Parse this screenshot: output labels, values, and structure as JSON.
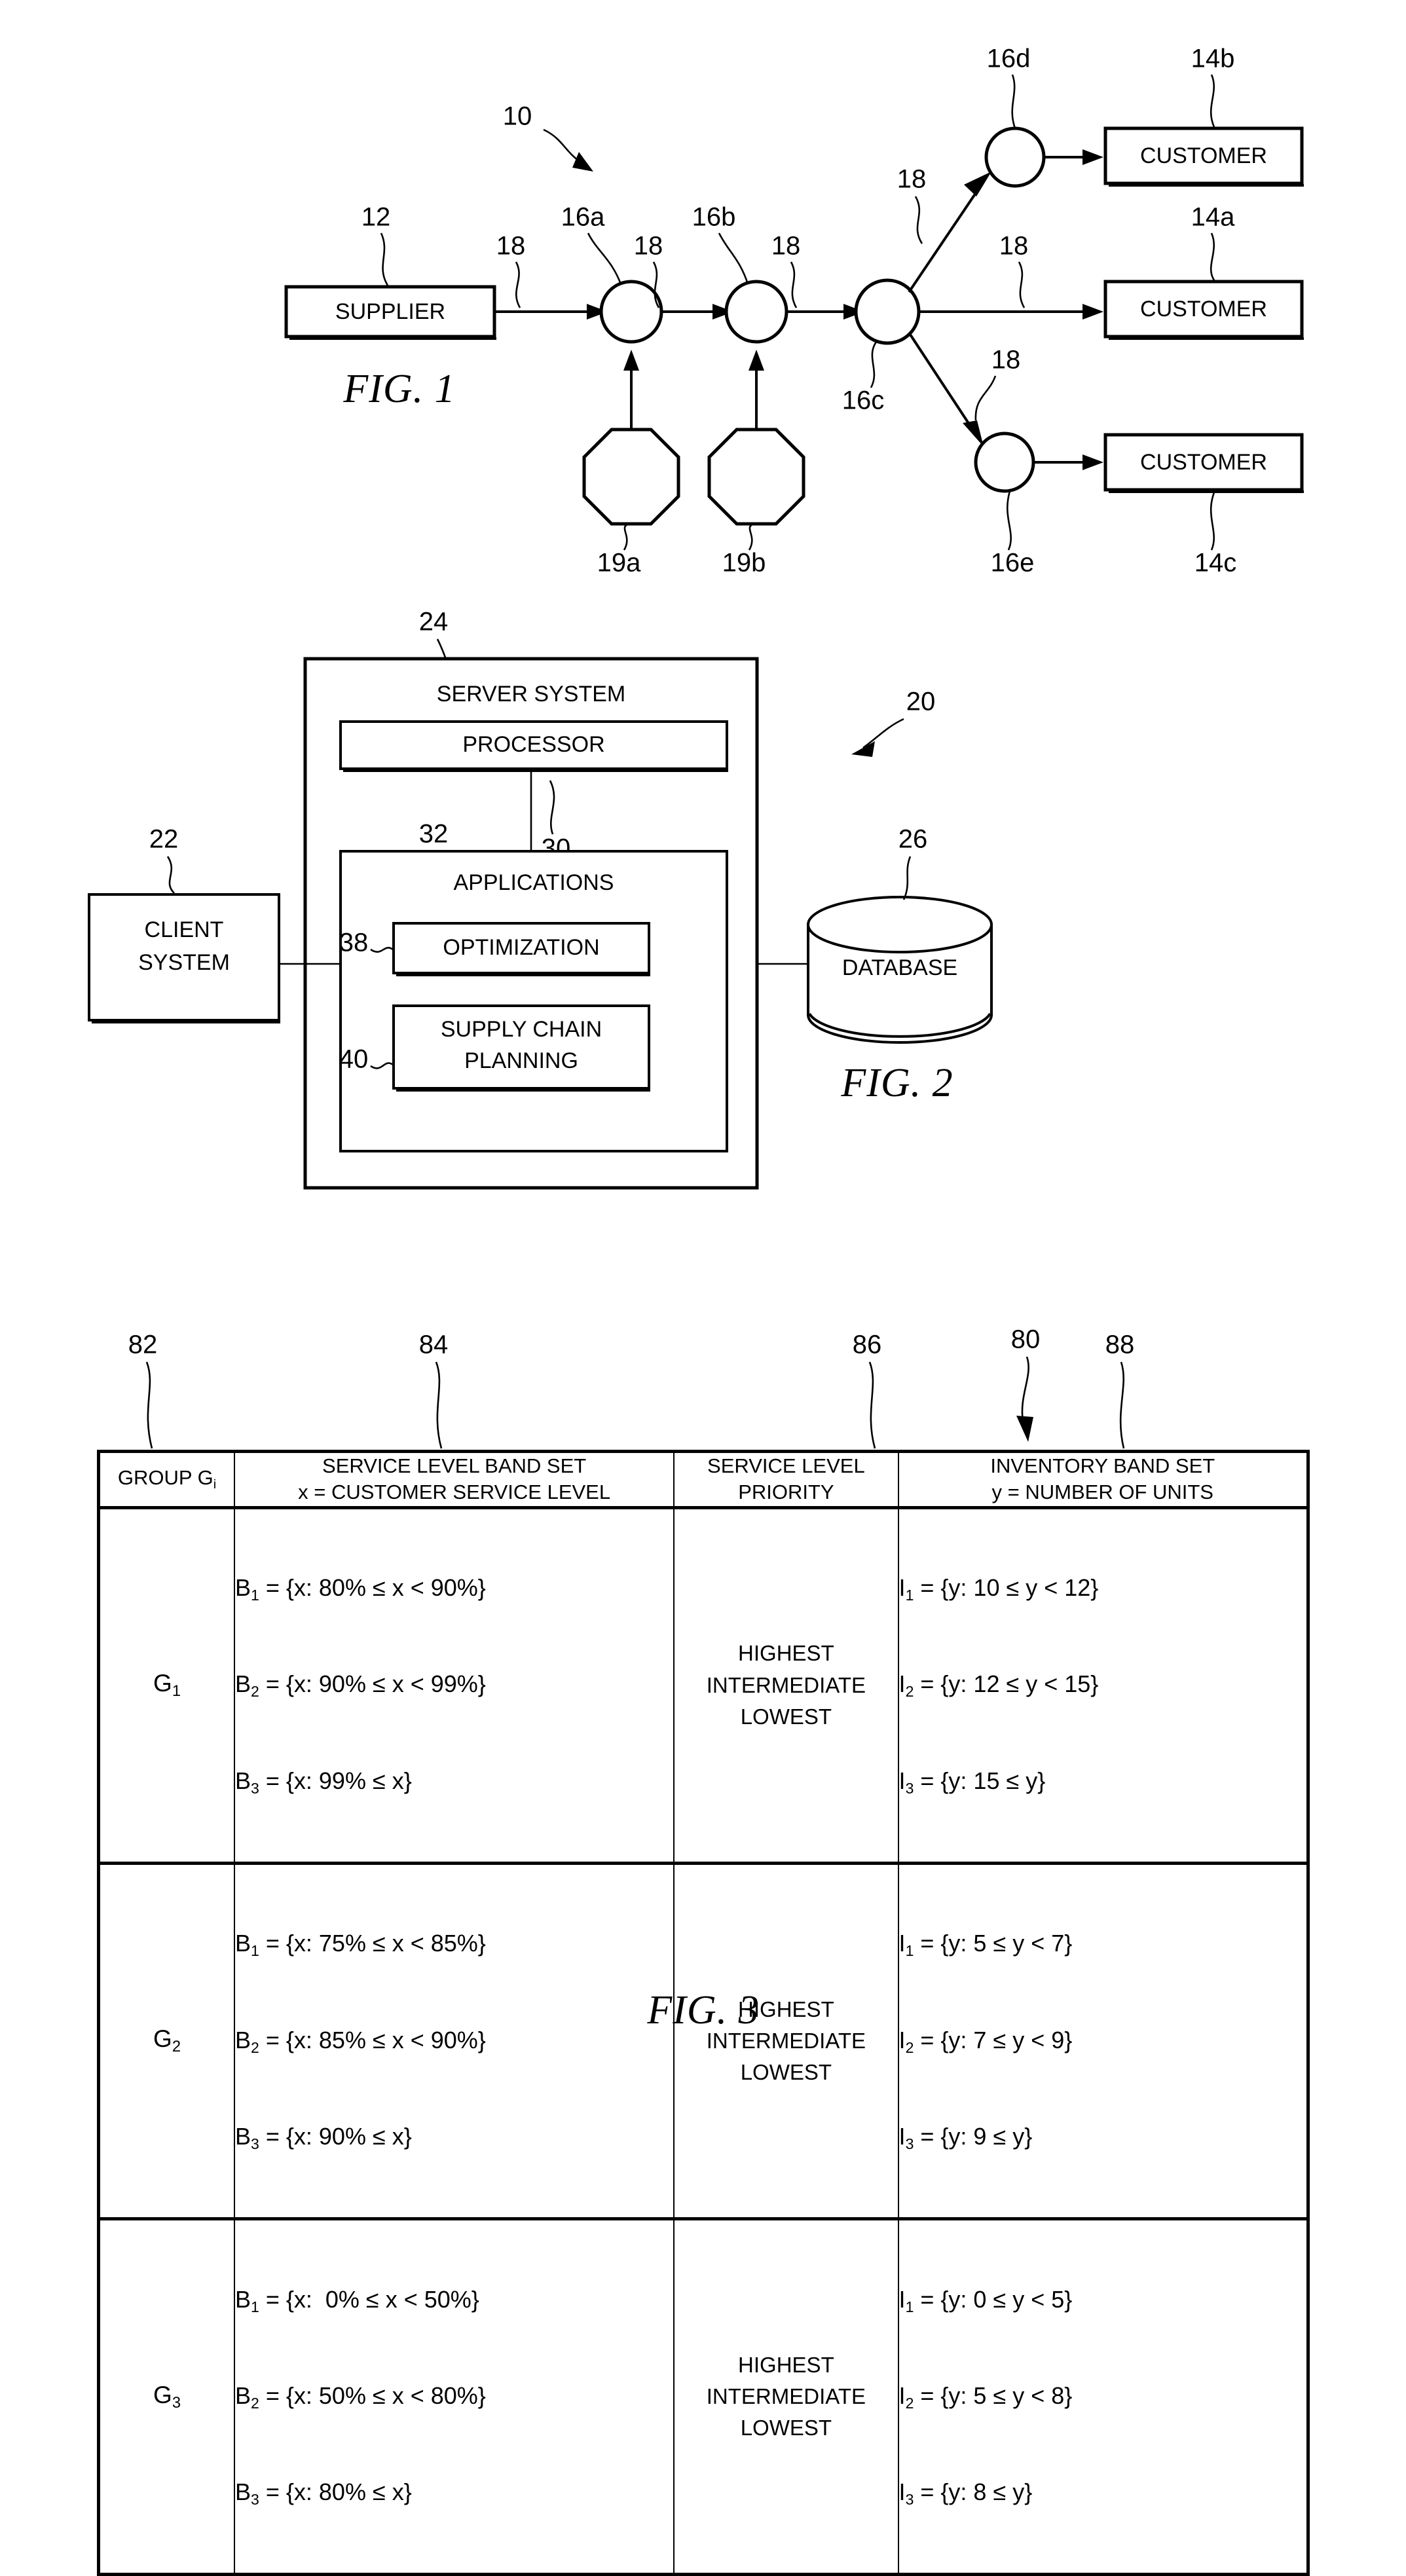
{
  "figure1": {
    "caption": "FIG. 1",
    "supplier_label": "SUPPLIER",
    "customer_a_label": "CUSTOMER",
    "customer_b_label": "CUSTOMER",
    "customer_c_label": "CUSTOMER",
    "refs": {
      "system": "10",
      "supplier": "12",
      "customer_a": "14a",
      "customer_b": "14b",
      "customer_c": "14c",
      "node_a": "16a",
      "node_b": "16b",
      "node_c": "16c",
      "node_d": "16d",
      "node_e": "16e",
      "link_1": "18",
      "link_2": "18",
      "link_3": "18",
      "link_4": "18",
      "link_5": "18",
      "link_6": "18",
      "link_7": "18",
      "source_a": "19a",
      "source_b": "19b"
    }
  },
  "figure2": {
    "caption": "FIG. 2",
    "server_system_label": "SERVER SYSTEM",
    "processor_label": "PROCESSOR",
    "applications_label": "APPLICATIONS",
    "optimization_label": "OPTIMIZATION",
    "supply_chain_planning_label_line1": "SUPPLY CHAIN",
    "supply_chain_planning_label_line2": "PLANNING",
    "client_system_label_line1": "CLIENT",
    "client_system_label_line2": "SYSTEM",
    "database_label": "DATABASE",
    "refs": {
      "system": "20",
      "client_system": "22",
      "server_system": "24",
      "database": "26",
      "processor_link": "30",
      "applications_link": "32",
      "optimization": "38",
      "supply_chain_planning": "40"
    }
  },
  "figure3": {
    "caption": "FIG. 3",
    "refs": {
      "table": "80",
      "group_column": "82",
      "service_level_band_set_column": "84",
      "service_level_priority_column": "86",
      "inventory_band_set_column": "88"
    },
    "headers": [
      {
        "line1": "GROUP G",
        "sub1": "i",
        "line2": ""
      },
      {
        "line1": "SERVICE LEVEL BAND SET",
        "sub1": "",
        "line2": "x = CUSTOMER SERVICE LEVEL"
      },
      {
        "line1": "SERVICE LEVEL",
        "sub1": "",
        "line2": "PRIORITY"
      },
      {
        "line1": "INVENTORY BAND SET",
        "sub1": "",
        "line2": "y = NUMBER OF UNITS"
      }
    ],
    "rows": [
      {
        "group": "G",
        "group_sub": "1",
        "bands": [
          {
            "name": "B",
            "sub": "1",
            "expr": " = {x: 80% ≤ x < 90%}"
          },
          {
            "name": "B",
            "sub": "2",
            "expr": " = {x: 90% ≤ x < 99%}"
          },
          {
            "name": "B",
            "sub": "3",
            "expr": " = {x: 99% ≤ x}"
          }
        ],
        "priorities": [
          "HIGHEST",
          "INTERMEDIATE",
          "LOWEST"
        ],
        "inventory": [
          {
            "name": "I",
            "sub": "1",
            "expr": " = {y: 10 ≤ y < 12}"
          },
          {
            "name": "I",
            "sub": "2",
            "expr": " = {y: 12 ≤ y < 15}"
          },
          {
            "name": "I",
            "sub": "3",
            "expr": " = {y: 15 ≤ y}"
          }
        ]
      },
      {
        "group": "G",
        "group_sub": "2",
        "bands": [
          {
            "name": "B",
            "sub": "1",
            "expr": " = {x: 75% ≤ x < 85%}"
          },
          {
            "name": "B",
            "sub": "2",
            "expr": " = {x: 85% ≤ x < 90%}"
          },
          {
            "name": "B",
            "sub": "3",
            "expr": " = {x: 90% ≤ x}"
          }
        ],
        "priorities": [
          "HIGHEST",
          "INTERMEDIATE",
          "LOWEST"
        ],
        "inventory": [
          {
            "name": "I",
            "sub": "1",
            "expr": " = {y: 5 ≤ y < 7}"
          },
          {
            "name": "I",
            "sub": "2",
            "expr": " = {y: 7 ≤ y < 9}"
          },
          {
            "name": "I",
            "sub": "3",
            "expr": " = {y: 9 ≤ y}"
          }
        ]
      },
      {
        "group": "G",
        "group_sub": "3",
        "bands": [
          {
            "name": "B",
            "sub": "1",
            "expr": " = {x:  0% ≤ x < 50%}"
          },
          {
            "name": "B",
            "sub": "2",
            "expr": " = {x: 50% ≤ x < 80%}"
          },
          {
            "name": "B",
            "sub": "3",
            "expr": " = {x: 80% ≤ x}"
          }
        ],
        "priorities": [
          "HIGHEST",
          "INTERMEDIATE",
          "LOWEST"
        ],
        "inventory": [
          {
            "name": "I",
            "sub": "1",
            "expr": " = {y: 0 ≤ y < 5}"
          },
          {
            "name": "I",
            "sub": "2",
            "expr": " = {y: 5 ≤ y < 8}"
          },
          {
            "name": "I",
            "sub": "3",
            "expr": " = {y: 8 ≤ y}"
          }
        ]
      }
    ]
  }
}
